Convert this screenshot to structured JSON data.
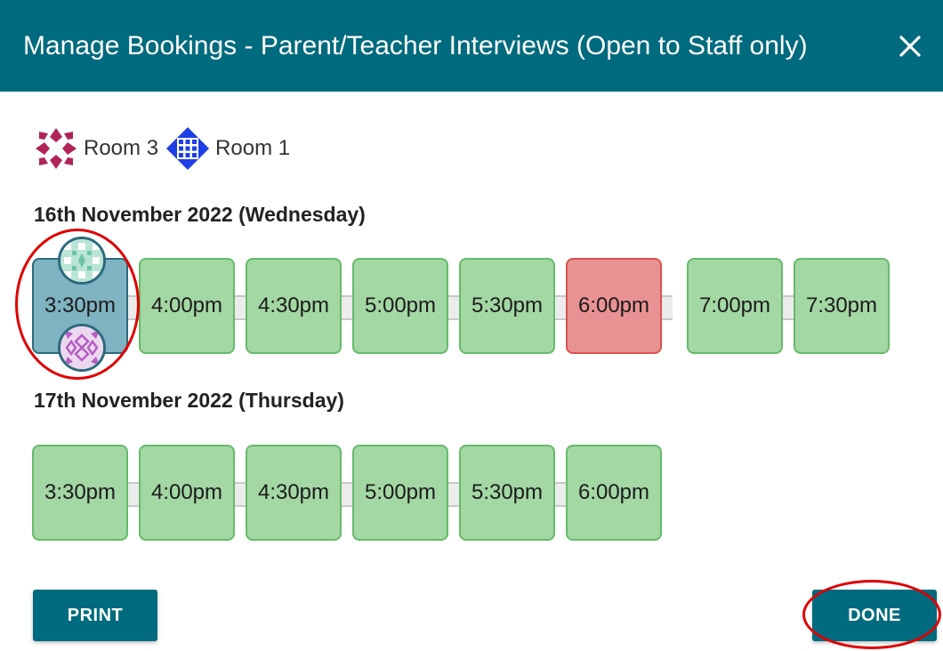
{
  "dialog": {
    "title": "Manage Bookings - Parent/Teacher Interviews (Open to Staff only)",
    "close_icon": "close-icon"
  },
  "legend": [
    {
      "label": "Room 3",
      "icon": "room-3-pattern-icon",
      "color": "#b0245a"
    },
    {
      "label": "Room 1",
      "icon": "room-1-pattern-icon",
      "color": "#1f3fe6"
    }
  ],
  "days": [
    {
      "date": "16th November 2022",
      "weekday": "(Wednesday)",
      "slots": [
        {
          "time": "3:30pm",
          "status": "booked"
        },
        {
          "time": "4:00pm",
          "status": "available"
        },
        {
          "time": "4:30pm",
          "status": "available"
        },
        {
          "time": "5:00pm",
          "status": "available"
        },
        {
          "time": "5:30pm",
          "status": "available"
        },
        {
          "time": "6:00pm",
          "status": "unavailable"
        },
        {
          "time": "7:00pm",
          "status": "available"
        },
        {
          "time": "7:30pm",
          "status": "available"
        }
      ]
    },
    {
      "date": "17th November 2022",
      "weekday": "(Thursday)",
      "slots": [
        {
          "time": "3:30pm",
          "status": "available"
        },
        {
          "time": "4:00pm",
          "status": "available"
        },
        {
          "time": "4:30pm",
          "status": "available"
        },
        {
          "time": "5:00pm",
          "status": "available"
        },
        {
          "time": "5:30pm",
          "status": "available"
        },
        {
          "time": "6:00pm",
          "status": "available"
        }
      ]
    }
  ],
  "buttons": {
    "print": "PRINT",
    "done": "DONE"
  },
  "colors": {
    "header": "#006a7e",
    "available": "#a3d7a4",
    "unavailable": "#e99294",
    "booked": "#7fb3c2",
    "annotation": "#e00000"
  }
}
